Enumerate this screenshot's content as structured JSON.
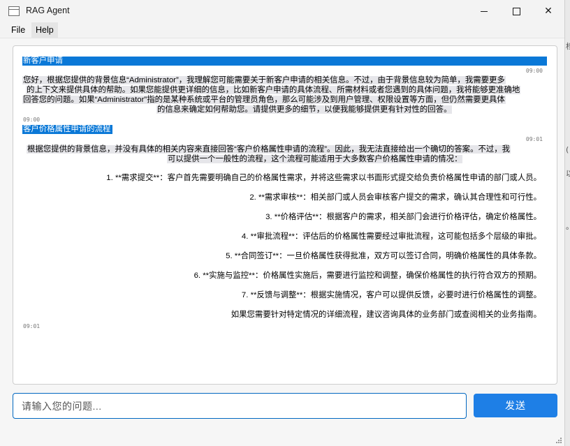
{
  "window": {
    "title": "RAG Agent",
    "controls": {
      "minimize": "—",
      "maximize": "☐",
      "close": "✕"
    }
  },
  "menu": {
    "file": "File",
    "help": "Help"
  },
  "messages": [
    {
      "role": "user",
      "text": "新客户申请",
      "time": "09:00"
    },
    {
      "role": "assistant",
      "lines": [
        "您好，根据您提供的背景信息“Administrator”，我理解您可能需要关于新客户申请的相关信息。不过，由于背景信息较为简单，我需要更多",
        "的上下文来提供具体的帮助。如果您能提供更详细的信息，比如新客户申请的具体流程、所需材料或者您遇到的具体问题，我将能够更准确地",
        "回答您的问题。如果“Administrator”指的是某种系统或平台的管理员角色，那么可能涉及到用户管理、权限设置等方面，但仍然需要更具体",
        "的信息来确定如何帮助您。请提供更多的细节，以便我能够提供更有针对性的回答。"
      ],
      "time": "09:00"
    },
    {
      "role": "user",
      "text": "客户价格属性申请的流程",
      "time": "09:01"
    },
    {
      "role": "assistant",
      "lines": [
        "根据您提供的背景信息，并没有具体的相关内容来直接回答“客户价格属性申请的流程”。因此，我无法直接给出一个确切的答案。不过，我",
        "可以提供一个一般性的流程，这个流程可能适用于大多数客户价格属性申请的情况："
      ],
      "steps": [
        "1. **需求提交**：客户首先需要明确自己的价格属性需求，并将这些需求以书面形式提交给负责价格属性申请的部门或人员。",
        "2. **需求审核**：相关部门或人员会审核客户提交的需求，确认其合理性和可行性。",
        "3. **价格评估**：根据客户的需求，相关部门会进行价格评估，确定价格属性。",
        "4. **审批流程**：评估后的价格属性需要经过审批流程，这可能包括多个层级的审批。",
        "5. **合同签订**：一旦价格属性获得批准，双方可以签订合同，明确价格属性的具体条款。",
        "6. **实施与监控**：价格属性实施后，需要进行监控和调整，确保价格属性的执行符合双方的预期。",
        "7. **反馈与调整**：根据实施情况，客户可以提供反馈，必要时进行价格属性的调整。"
      ],
      "closing": "如果您需要针对特定情况的详细流程，建议咨询具体的业务部门或查阅相关的业务指南。",
      "time": "09:01"
    }
  ],
  "input": {
    "placeholder": "请输入您的问题..."
  },
  "send_button": {
    "label": "发送"
  },
  "background_window_glyphs": [
    "档",
    "(",
    "以",
    "。"
  ]
}
